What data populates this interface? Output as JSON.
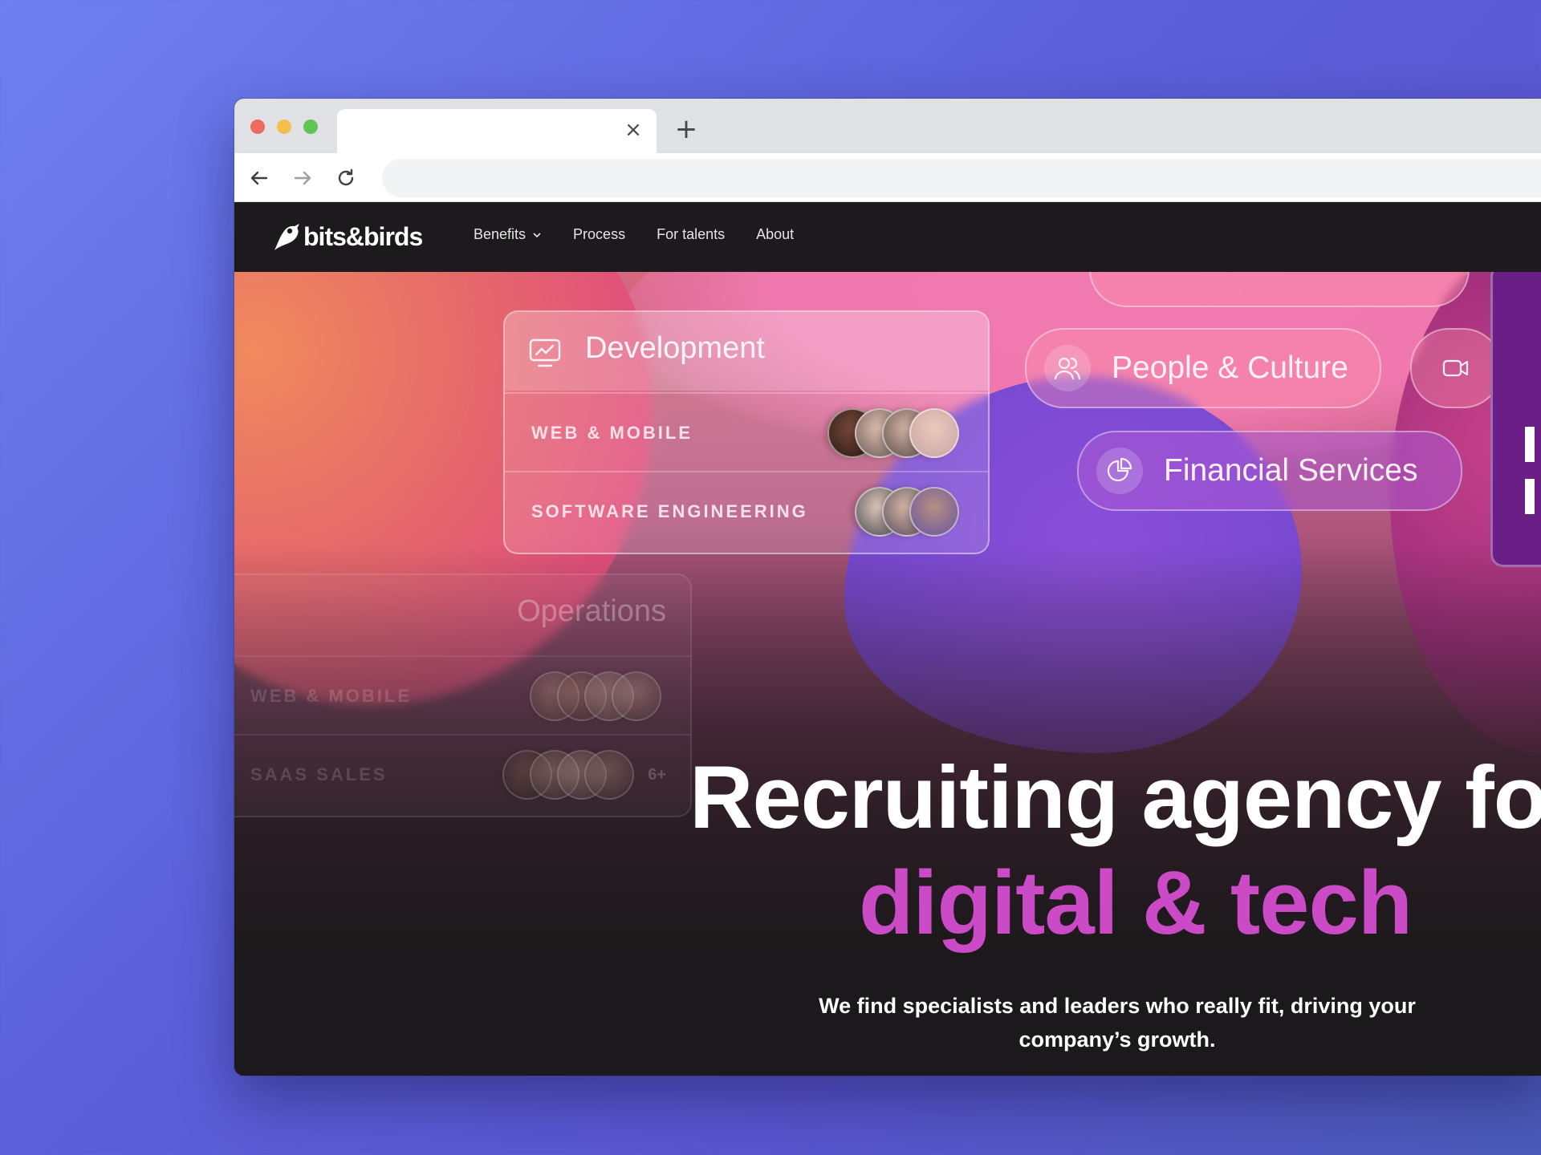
{
  "browser": {
    "tab_close_icon": "close-icon",
    "new_tab_symbol": "+",
    "tab_close_symbol": "×"
  },
  "site": {
    "logo_text": "bits&birds",
    "nav": [
      {
        "label": "Benefits",
        "has_dropdown": true
      },
      {
        "label": "Process"
      },
      {
        "label": "For talents"
      },
      {
        "label": "About"
      }
    ]
  },
  "hero": {
    "cards": {
      "development": {
        "title": "Development",
        "rows": [
          "WEB & MOBILE",
          "SOFTWARE ENGINEERING"
        ]
      },
      "operations": {
        "title": "Operations",
        "rows": [
          "WEB & MOBILE",
          "SAAS SALES"
        ],
        "extra_count": "6+"
      }
    },
    "pills": {
      "people": "People & Culture",
      "financial": "Financial Services"
    },
    "headline_line1": "Recruiting agency fo",
    "headline_line2": "digital & tech",
    "subtitle": "We find specialists and leaders who really fit, driving your company’s growth."
  },
  "colors": {
    "accent_magenta": "#cb4bc6",
    "nav_bg": "#1c1a1c",
    "purple_blob": "#7b4ad3"
  }
}
